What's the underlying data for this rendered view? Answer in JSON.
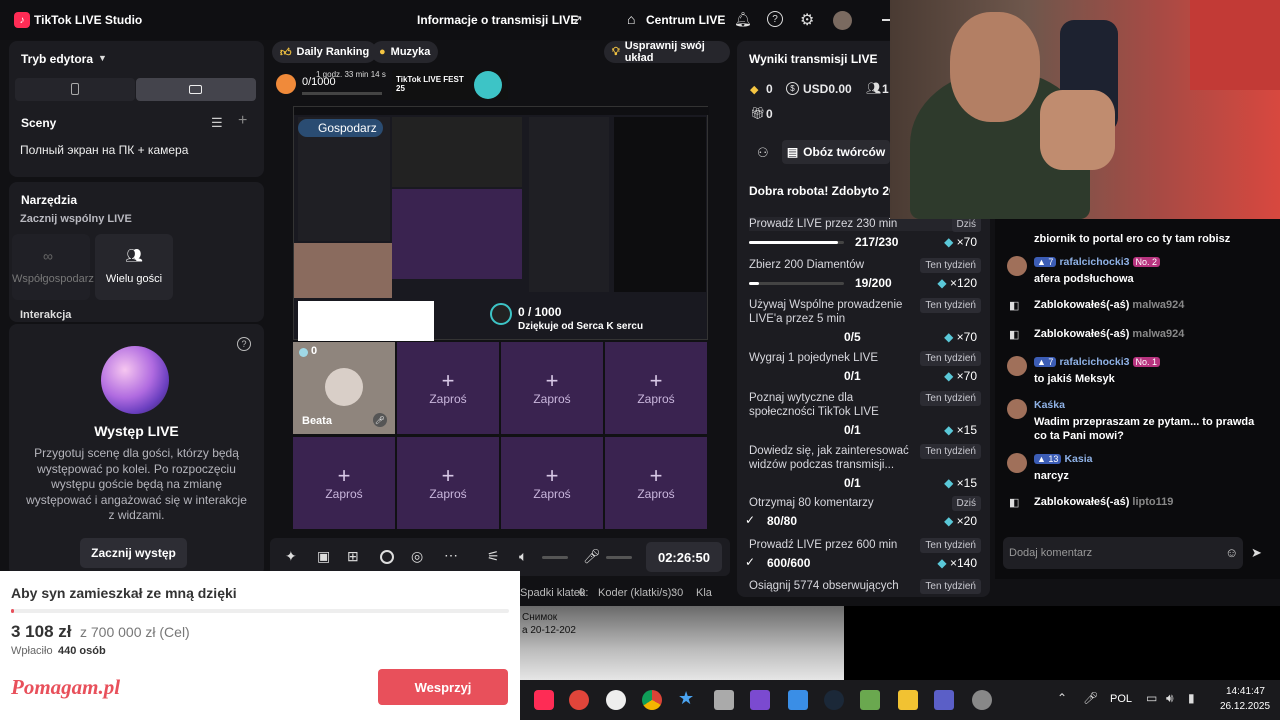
{
  "app": {
    "title": "TikTok LIVE Studio",
    "stream_info": "Informacje o transmisji LIVE",
    "center_btn": "Centrum LIVE"
  },
  "left": {
    "editor_mode": "Tryb edytora",
    "scenes_title": "Sceny",
    "scene_item": "Полный экран на ПК + камера",
    "tools_title": "Narzędzia",
    "tools_sub": "Zacznij wspólny LIVE",
    "cohost": "Współgospodarz",
    "multi_guest": "Wielu gości",
    "interaction": "Interakcja",
    "live_perf_title": "Występ LIVE",
    "live_perf_desc": "Przygotuj scenę dla gości, którzy będą występować po kolei. Po rozpoczęciu występu goście będą na zmianę występować i angażować się w interakcje z widzami.",
    "start_perf": "Zacznij występ"
  },
  "center": {
    "chip_ranking": "Daily Ranking",
    "chip_music": "Muzyka",
    "chip_improve": "Usprawnij swój układ",
    "goal_count": "0/1000",
    "goal_time": "1 godz. 33 min 14 s",
    "fest": "TikTok LIVE FEST 25",
    "host_label": "Gospodarz",
    "serca": "0 / 1000",
    "serca_sub": "Dziękuje od Serca K sercu",
    "guest_name": "Beata",
    "guest_count": "0",
    "slot_label": "Zaproś",
    "timer": "02:26:50",
    "status_frames": "Spadki klatek:",
    "status_frames_val": "0",
    "status_encoder": "Koder (klatki/s):",
    "status_encoder_val": "30",
    "status_more": "Kla"
  },
  "stats": {
    "title": "Wyniki transmisji LIVE",
    "diamonds": "0",
    "usd": "USD0.00",
    "viewers": "1",
    "gifts": "0",
    "creators_btn": "Obóz twórców",
    "good_job": "Dobra robota! Zdobyto 20",
    "tasks": [
      {
        "name": "Prowadź LIVE przez 230 min",
        "badge": "Dziś",
        "progress": "217/230",
        "reward": "×70",
        "fill": 0.94
      },
      {
        "name": "Zbierz 200 Diamentów",
        "badge": "Ten tydzień",
        "progress": "19/200",
        "reward": "×120",
        "fill": 0.1
      },
      {
        "name": "Używaj Wspólne prowadzenie LIVE'a przez 5 min",
        "badge": "Ten tydzień",
        "progress": "0/5",
        "reward": "×70",
        "fill": 0
      },
      {
        "name": "Wygraj 1 pojedynek LIVE",
        "badge": "Ten tydzień",
        "progress": "0/1",
        "reward": "×70",
        "fill": 0
      },
      {
        "name": "Poznaj wytyczne dla społeczności TikTok LIVE",
        "badge": "Ten tydzień",
        "progress": "0/1",
        "reward": "×15",
        "fill": 0
      },
      {
        "name": "Dowiedz się, jak zainteresować widzów podczas transmisji...",
        "badge": "Ten tydzień",
        "progress": "0/1",
        "reward": "×15",
        "fill": 0
      },
      {
        "name": "Otrzymaj 80 komentarzy",
        "badge": "Dziś",
        "progress": "80/80",
        "reward": "×20",
        "fill": 1
      },
      {
        "name": "Prowadź LIVE przez 600 min",
        "badge": "Ten tydzień",
        "progress": "600/600",
        "reward": "×140",
        "fill": 1
      },
      {
        "name": "Osiągnij 5774 obserwujących",
        "badge": "Ten tydzień",
        "progress": "",
        "reward": "",
        "fill": 0
      }
    ]
  },
  "chat": {
    "messages": [
      {
        "type": "text",
        "user": "",
        "text": "zbiornik to portal ero co ty tam robisz"
      },
      {
        "type": "user",
        "user": "rafalcichocki3",
        "level": "7",
        "rank": "No. 2",
        "text": "afera podsłuchowa"
      },
      {
        "type": "system",
        "text": "Zablokowałeś(-aś)",
        "target": "malwa924"
      },
      {
        "type": "system",
        "text": "Zablokowałeś(-aś)",
        "target": "malwa924"
      },
      {
        "type": "user",
        "user": "rafalcichocki3",
        "level": "7",
        "rank": "No. 1",
        "text": "to jakiś Meksyk"
      },
      {
        "type": "user",
        "user": "Kaśka",
        "level": "",
        "rank": "",
        "text": "Wadim przepraszam ze pytam... to prawda co ta Pani mowi?"
      },
      {
        "type": "user",
        "user": "Kasia",
        "level": "13",
        "rank": "",
        "text": "narcyz"
      },
      {
        "type": "system",
        "text": "Zablokowałeś(-aś)",
        "target": "lipto119"
      }
    ],
    "placeholder": "Dodaj komentarz"
  },
  "donation": {
    "title": "Aby syn zamieszkał ze mną dzięki",
    "amount": "3 108 zł",
    "goal": "z 700 000 zł (Cel)",
    "payers_label": "Wpłaciło",
    "payers": "440 osób",
    "brand": "Pomagam.pl",
    "button": "Wesprzyj",
    "progress": 0.0044
  },
  "video": {
    "caption1": "Снимок",
    "caption2": "а 20-12-202"
  },
  "taskbar": {
    "lang": "POL",
    "time": "14:41:47",
    "date": "26.12.2025"
  },
  "colors": {
    "accent": "#fe2c55",
    "donate": "#e8505b",
    "slot": "#3a2350"
  }
}
